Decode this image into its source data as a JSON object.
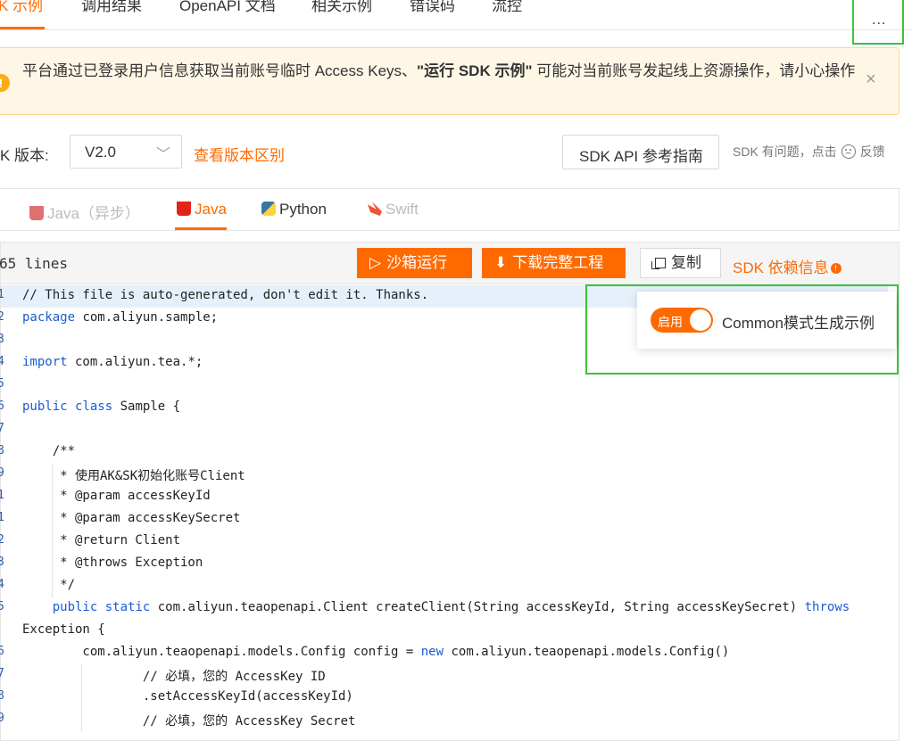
{
  "top_tabs": [
    "K 示例",
    "调用结果",
    "OpenAPI 文档",
    "相关示例",
    "错误码",
    "流控"
  ],
  "warning": {
    "prefix": "平台通过已登录用户信息获取当前账号临时 Access Keys、",
    "bold": "\"运行 SDK 示例\"",
    "suffix": " 可能对当前账号发起线上资源操作，请小心操作",
    "close": "×",
    "icon": "!"
  },
  "version": {
    "label": "K 版本:",
    "value": "V2.0",
    "diff_link": "查看版本区别",
    "ref_button": "SDK API 参考指南",
    "feedback_prefix": "SDK 有问题，点击",
    "feedback_suffix": "反馈"
  },
  "languages": [
    {
      "label": "Java（异步）",
      "icon": "java-cup-icon"
    },
    {
      "label": "Java",
      "icon": "java-cup-icon"
    },
    {
      "label": "Python",
      "icon": "python-icon"
    },
    {
      "label": "Swift",
      "icon": "swift-icon"
    }
  ],
  "toolbar": {
    "lines": "65 lines",
    "run": "沙箱运行",
    "download": "下载完整工程",
    "copy": "复制",
    "deps": "SDK 依赖信息",
    "deps_badge": "!",
    "more": "..."
  },
  "popup": {
    "toggle_label": "启用",
    "toggle_on": true,
    "text": "Common模式生成示例"
  },
  "code_lines": [
    {
      "n": "1",
      "t": "// This file is auto-generated, don't edit it. Thanks."
    },
    {
      "n": "2",
      "t": "package com.aliyun.sample;"
    },
    {
      "n": "3",
      "t": ""
    },
    {
      "n": "4",
      "t": "import com.aliyun.tea.*;"
    },
    {
      "n": "5",
      "t": ""
    },
    {
      "n": "6",
      "t": "public class Sample {"
    },
    {
      "n": "7",
      "t": ""
    },
    {
      "n": "8",
      "t": "    /**"
    },
    {
      "n": "9",
      "t": "     * 使用AK&SK初始化账号Client"
    },
    {
      "n": "1",
      "t": "     * @param accessKeyId"
    },
    {
      "n": "1",
      "t": "     * @param accessKeySecret"
    },
    {
      "n": "2",
      "t": "     * @return Client"
    },
    {
      "n": "3",
      "t": "     * @throws Exception"
    },
    {
      "n": "4",
      "t": "     */"
    },
    {
      "n": "5",
      "t": "    public static com.aliyun.teaopenapi.Client createClient(String accessKeyId, String accessKeySecret) throws"
    },
    {
      "n": "",
      "t": "Exception {"
    },
    {
      "n": "6",
      "t": "        com.aliyun.teaopenapi.models.Config config = new com.aliyun.teaopenapi.models.Config()"
    },
    {
      "n": "7",
      "t": "                // 必填，您的 AccessKey ID"
    },
    {
      "n": "8",
      "t": "                .setAccessKeyId(accessKeyId)"
    },
    {
      "n": "9",
      "t": "                // 必填，您的 AccessKey Secret"
    }
  ]
}
